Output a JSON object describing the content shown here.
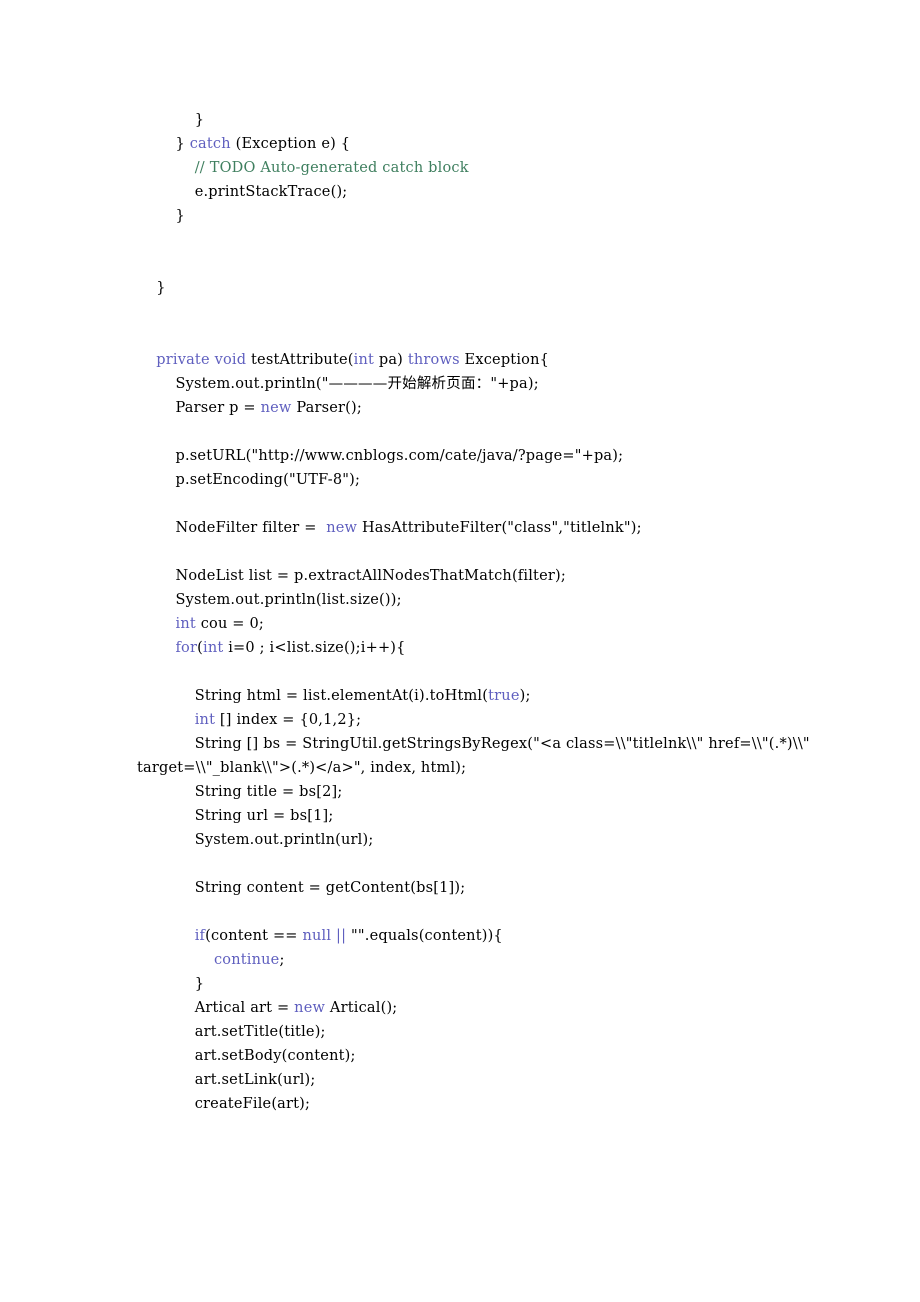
{
  "document": {
    "type": "code-listing",
    "language": "java",
    "page_background": "#ffffff",
    "colors": {
      "text": "#000000",
      "keyword": "#5f5fbf",
      "comment": "#3f7f5f"
    },
    "lines": [
      {
        "indent": 12,
        "segments": [
          {
            "t": "}",
            "c": "pl"
          }
        ]
      },
      {
        "indent": 8,
        "segments": [
          {
            "t": "} ",
            "c": "pl"
          },
          {
            "t": "catch",
            "c": "kw"
          },
          {
            "t": " (Exception e) {",
            "c": "pl"
          }
        ]
      },
      {
        "indent": 12,
        "segments": [
          {
            "t": "// TODO Auto-generated catch block",
            "c": "cm"
          }
        ]
      },
      {
        "indent": 12,
        "segments": [
          {
            "t": "e.printStackTrace();",
            "c": "pl"
          }
        ]
      },
      {
        "indent": 8,
        "segments": [
          {
            "t": "}",
            "c": "pl"
          }
        ]
      },
      {
        "indent": 0,
        "segments": []
      },
      {
        "indent": 0,
        "segments": []
      },
      {
        "indent": 4,
        "segments": [
          {
            "t": "}",
            "c": "pl"
          }
        ]
      },
      {
        "indent": 0,
        "segments": []
      },
      {
        "indent": 0,
        "segments": []
      },
      {
        "indent": 4,
        "segments": [
          {
            "t": "private",
            "c": "kw"
          },
          {
            "t": " ",
            "c": "pl"
          },
          {
            "t": "void",
            "c": "kw"
          },
          {
            "t": " testAttribute(",
            "c": "pl"
          },
          {
            "t": "int",
            "c": "kw"
          },
          {
            "t": " pa) ",
            "c": "pl"
          },
          {
            "t": "throws",
            "c": "kw"
          },
          {
            "t": " Exception{",
            "c": "pl"
          }
        ]
      },
      {
        "indent": 8,
        "segments": [
          {
            "t": "System.out.println(\"————开始解析页面：\"+pa);",
            "c": "pl"
          }
        ]
      },
      {
        "indent": 8,
        "segments": [
          {
            "t": "Parser p = ",
            "c": "pl"
          },
          {
            "t": "new",
            "c": "kw"
          },
          {
            "t": " Parser();",
            "c": "pl"
          }
        ]
      },
      {
        "indent": 0,
        "segments": []
      },
      {
        "indent": 8,
        "segments": [
          {
            "t": "p.setURL(\"http://www.cnblogs.com/cate/java/?page=\"+pa);",
            "c": "pl"
          }
        ]
      },
      {
        "indent": 8,
        "segments": [
          {
            "t": "p.setEncoding(\"UTF-8\");",
            "c": "pl"
          }
        ]
      },
      {
        "indent": 0,
        "segments": []
      },
      {
        "indent": 8,
        "segments": [
          {
            "t": "NodeFilter filter =  ",
            "c": "pl"
          },
          {
            "t": "new",
            "c": "kw"
          },
          {
            "t": " HasAttributeFilter(\"class\",\"titlelnk\");",
            "c": "pl"
          }
        ]
      },
      {
        "indent": 0,
        "segments": []
      },
      {
        "indent": 8,
        "segments": [
          {
            "t": "NodeList list = p.extractAllNodesThatMatch(filter);",
            "c": "pl"
          }
        ]
      },
      {
        "indent": 8,
        "segments": [
          {
            "t": "System.out.println(list.size());",
            "c": "pl"
          }
        ]
      },
      {
        "indent": 8,
        "segments": [
          {
            "t": "int",
            "c": "kw"
          },
          {
            "t": " cou = 0;",
            "c": "pl"
          }
        ]
      },
      {
        "indent": 8,
        "segments": [
          {
            "t": "for",
            "c": "kw"
          },
          {
            "t": "(",
            "c": "pl"
          },
          {
            "t": "int",
            "c": "kw"
          },
          {
            "t": " i=0 ; i<list.size();i++){",
            "c": "pl"
          }
        ]
      },
      {
        "indent": 0,
        "segments": []
      },
      {
        "indent": 12,
        "segments": [
          {
            "t": "String html = list.elementAt(i).toHtml(",
            "c": "pl"
          },
          {
            "t": "true",
            "c": "kw"
          },
          {
            "t": ");",
            "c": "pl"
          }
        ]
      },
      {
        "indent": 12,
        "segments": [
          {
            "t": "int",
            "c": "kw"
          },
          {
            "t": " [] index = {0,1,2};",
            "c": "pl"
          }
        ]
      },
      {
        "indent": 12,
        "segments": [
          {
            "t": "String [] bs = StringUtil.getStringsByRegex(\"<a class=\\\\\"titlelnk\\\\\" href=\\\\\"(.*)\\\\\" target=\\\\\"_blank\\\\\">(.*)</a>\", index, html);",
            "c": "pl"
          }
        ]
      },
      {
        "indent": 12,
        "segments": [
          {
            "t": "String title = bs[2];",
            "c": "pl"
          }
        ]
      },
      {
        "indent": 12,
        "segments": [
          {
            "t": "String url = bs[1];",
            "c": "pl"
          }
        ]
      },
      {
        "indent": 12,
        "segments": [
          {
            "t": "System.out.println(url);",
            "c": "pl"
          }
        ]
      },
      {
        "indent": 0,
        "segments": []
      },
      {
        "indent": 12,
        "segments": [
          {
            "t": "String content = getContent(bs[1]);",
            "c": "pl"
          }
        ]
      },
      {
        "indent": 0,
        "segments": []
      },
      {
        "indent": 12,
        "segments": [
          {
            "t": "if",
            "c": "kw"
          },
          {
            "t": "(content == ",
            "c": "pl"
          },
          {
            "t": "null",
            "c": "kw"
          },
          {
            "t": " ",
            "c": "pl"
          },
          {
            "t": "||",
            "c": "kw"
          },
          {
            "t": " \"\".equals(content)){",
            "c": "pl"
          }
        ]
      },
      {
        "indent": 16,
        "segments": [
          {
            "t": "continue",
            "c": "kw"
          },
          {
            "t": ";",
            "c": "pl"
          }
        ]
      },
      {
        "indent": 12,
        "segments": [
          {
            "t": "}",
            "c": "pl"
          }
        ]
      },
      {
        "indent": 12,
        "segments": [
          {
            "t": "Artical art = ",
            "c": "pl"
          },
          {
            "t": "new",
            "c": "kw"
          },
          {
            "t": " Artical();",
            "c": "pl"
          }
        ]
      },
      {
        "indent": 12,
        "segments": [
          {
            "t": "art.setTitle(title);",
            "c": "pl"
          }
        ]
      },
      {
        "indent": 12,
        "segments": [
          {
            "t": "art.setBody(content);",
            "c": "pl"
          }
        ]
      },
      {
        "indent": 12,
        "segments": [
          {
            "t": "art.setLink(url);",
            "c": "pl"
          }
        ]
      },
      {
        "indent": 12,
        "segments": [
          {
            "t": "createFile(art);",
            "c": "pl"
          }
        ]
      }
    ]
  }
}
